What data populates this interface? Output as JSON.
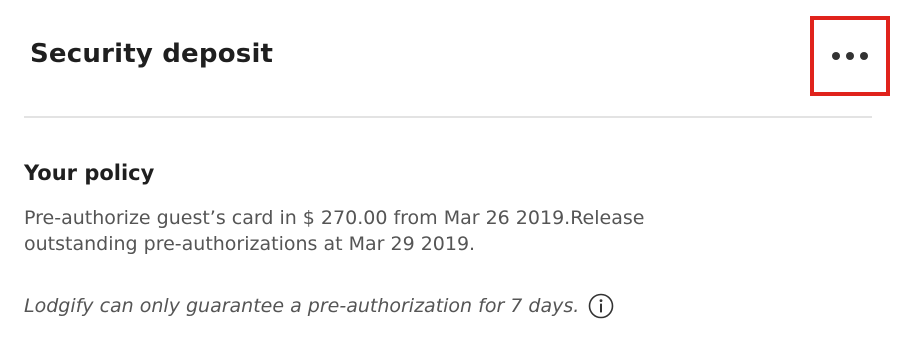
{
  "header": {
    "title": "Security deposit",
    "more_button_icon": "more-horizontal-icon",
    "highlight_color": "#e0231c"
  },
  "policy": {
    "heading": "Your policy",
    "line1": "Pre-authorize guest’s card in $ 270.00 from Mar 26 2019.Release",
    "line2": "outstanding pre-authorizations at Mar 29 2019.",
    "note": "Lodgify can only guarantee a pre-authorization for 7 days.",
    "note_icon": "info-icon"
  }
}
